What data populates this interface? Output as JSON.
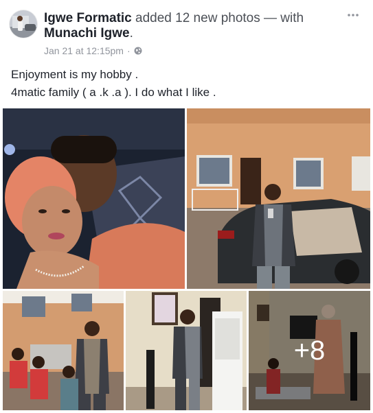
{
  "post": {
    "author": "Igwe Formatic",
    "action_text": " added 12 new photos — with ",
    "tagged": "Munachi Igwe",
    "tagged_suffix": ".",
    "timestamp": "Jan 21 at 12:15pm",
    "separator": "·",
    "privacy_icon": "globe-icon",
    "more_icon": "more-dots-icon",
    "caption_lines": [
      "Enjoyment is my hobby .",
      "4matic  family ( a .k .a ). I do what I like ."
    ],
    "more_photos_label": "+8"
  },
  "colors": {
    "name_text": "#1d2129",
    "meta_text": "#90949c",
    "overlay_text": "#ffffff"
  }
}
